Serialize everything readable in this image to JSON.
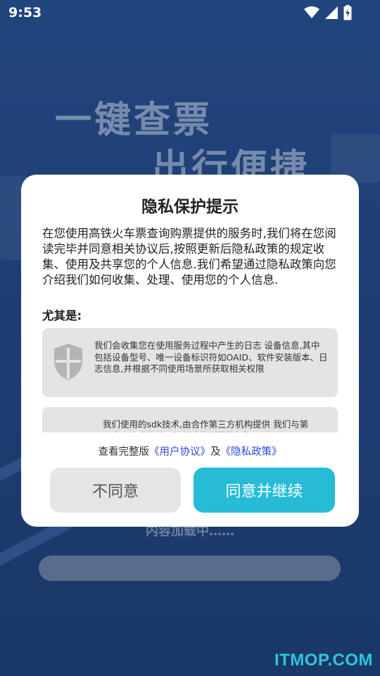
{
  "status_bar": {
    "time": "9:53",
    "icons": [
      "wifi-icon",
      "signal-icon",
      "battery-charging-icon"
    ]
  },
  "background": {
    "slogan_line1": "一键查票",
    "slogan_line2": "出行便捷",
    "loading_text": "内容加载中……"
  },
  "dialog": {
    "title": "隐私保护提示",
    "intro": "在您使用高铁火车票查询购票提供的服务时,我们将在您阅读完毕并同意相关协议后,按照更新后隐私政策的规定收集、使用及共享您的个人信息.我们希望通过隐私政策向您介绍我们如何收集、处理、使用您的个人信息.",
    "subheading": "尤其是:",
    "cards": [
      {
        "icon": "shield-icon",
        "text": "我们会收集您在使用服务过程中产生的日志 设备信息,其中包括设备型号、唯一设备标识符如OAID、软件安装版本、日志信息,并根据不同使用场景所获取相关权限"
      },
      {
        "text": "我们使用的sdk技术,由合作第三方机构提供 我们与第三方平台合作获取相关功能所需的权限"
      }
    ],
    "links": {
      "prefix": "查看完整版",
      "user_agreement": "《用户协议》",
      "and": "及",
      "privacy_policy": "《隐私政策》"
    },
    "disagree_label": "不同意",
    "agree_label": "同意并继续"
  },
  "watermark": "ITMOP.COM",
  "colors": {
    "accent": "#26bcd5",
    "link": "#2b4bd8",
    "overlay_bg": "#1f3f74"
  }
}
